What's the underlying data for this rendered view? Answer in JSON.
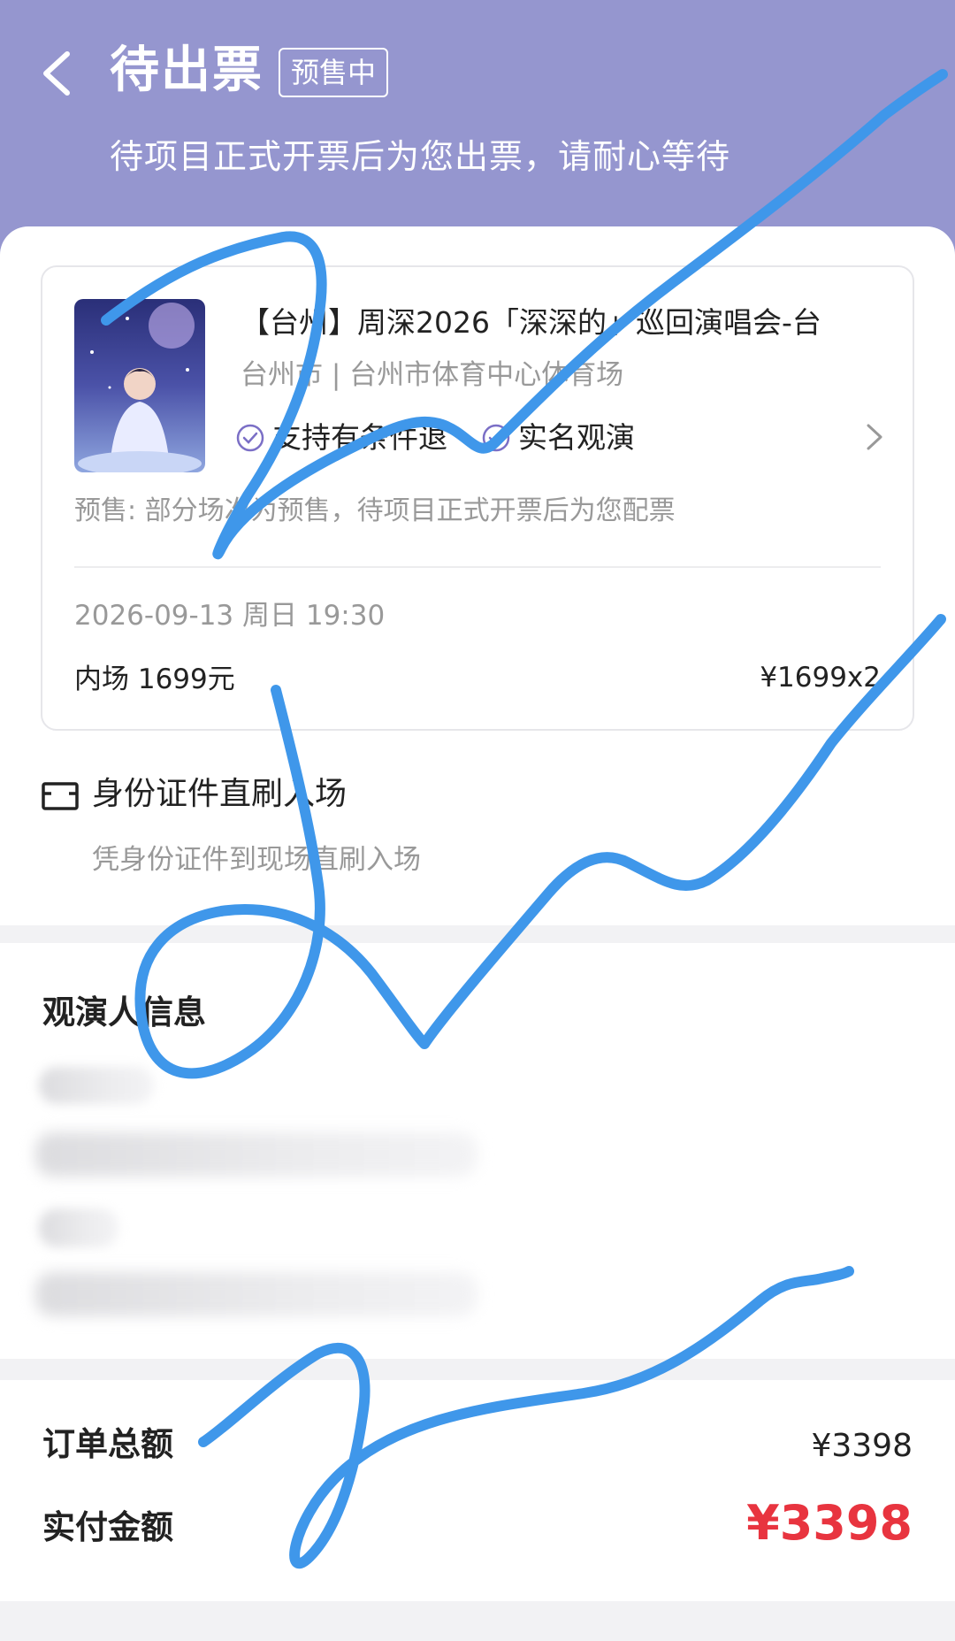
{
  "header": {
    "title": "待出票",
    "badge": "预售中",
    "subtitle": "待项目正式开票后为您出票，请耐心等待"
  },
  "order": {
    "show_title": "【台州】周深2026「深深的」巡回演唱会-台",
    "venue": "台州市 | 台州市体育中心体育场",
    "tags": [
      "支持有条件退",
      "实名观演"
    ],
    "presale_note": "预售: 部分场次为预售，待项目正式开票后为您配票",
    "datetime": "2026-09-13 周日 19:30",
    "seat": "内场 1699元",
    "price": "¥1699x2"
  },
  "entry": {
    "title": "身份证件直刷入场",
    "desc": "凭身份证件到现场直刷入场"
  },
  "viewers": {
    "title": "观演人信息"
  },
  "totals": {
    "order_total_label": "订单总额",
    "order_total_value": "¥3398",
    "paid_label": "实付金额",
    "paid_value": "¥3398"
  },
  "colors": {
    "header_bg": "#9596cf",
    "accent_red": "#e8343f",
    "scribble_blue": "#3f97ea"
  },
  "icons": {
    "back": "chevron-left-icon",
    "check": "check-circle-icon",
    "more": "chevron-right-icon",
    "entry": "id-card-icon"
  }
}
